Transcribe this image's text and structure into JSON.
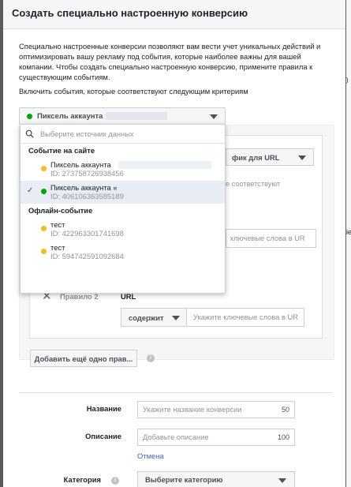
{
  "modal": {
    "title": "Создать специально настроенную конверсию",
    "intro": "Специально настроенные конверсии позволяют вам вести учет уникальных действий и оптимизировать вашу рекламу под события, которые наиболее важны для вашей компании. Чтобы создать специально настроенную конверсию, примените правила к существующим событиям.",
    "include_label": "Включить события, которые соответствуют следующим критериям"
  },
  "pixel_selector": {
    "label": "Пиксель аккаунта",
    "status_color": "#00a400"
  },
  "dropdown": {
    "search_placeholder": "Выберите источник данных",
    "sections": [
      {
        "title": "Событие на сайте",
        "items": [
          {
            "name": "Пиксель аккаунта",
            "id": "ID: 273758726938456",
            "status": "yellow",
            "selected": false
          },
          {
            "name": "Пиксель аккаунта «",
            "id": "ID: 406106363585189",
            "status": "green",
            "selected": true
          }
        ]
      },
      {
        "title": "Офлайн-событие",
        "items": [
          {
            "name": "тест",
            "id": "ID: 422963301741698",
            "status": "yellow",
            "selected": false
          },
          {
            "name": "тест",
            "id": "ID: 594742591092684",
            "status": "yellow",
            "selected": false
          }
        ]
      }
    ]
  },
  "rules": {
    "url_select": "фик для URL",
    "match_text": "е соответствуют",
    "keyword_placeholder_1": "ключевые слова в UR",
    "rule2_label": "Правило 2",
    "rule2_field": "URL",
    "contains_label": "содержит",
    "keyword_placeholder_2": "Укажите ключевые слова в UR",
    "add_rule_label": "Добавить ещё одно прав..."
  },
  "form": {
    "name_label": "Название",
    "name_placeholder": "Укажите название конверсии",
    "name_max": "50",
    "desc_label": "Описание",
    "desc_placeholder": "Добавьте описание",
    "desc_max": "100",
    "cancel_label": "Отмена",
    "category_label": "Категория",
    "category_select": "Выберите категорию"
  },
  "colors": {
    "green": "#00a400",
    "yellow": "#f7b928",
    "link": "#4267b2"
  }
}
